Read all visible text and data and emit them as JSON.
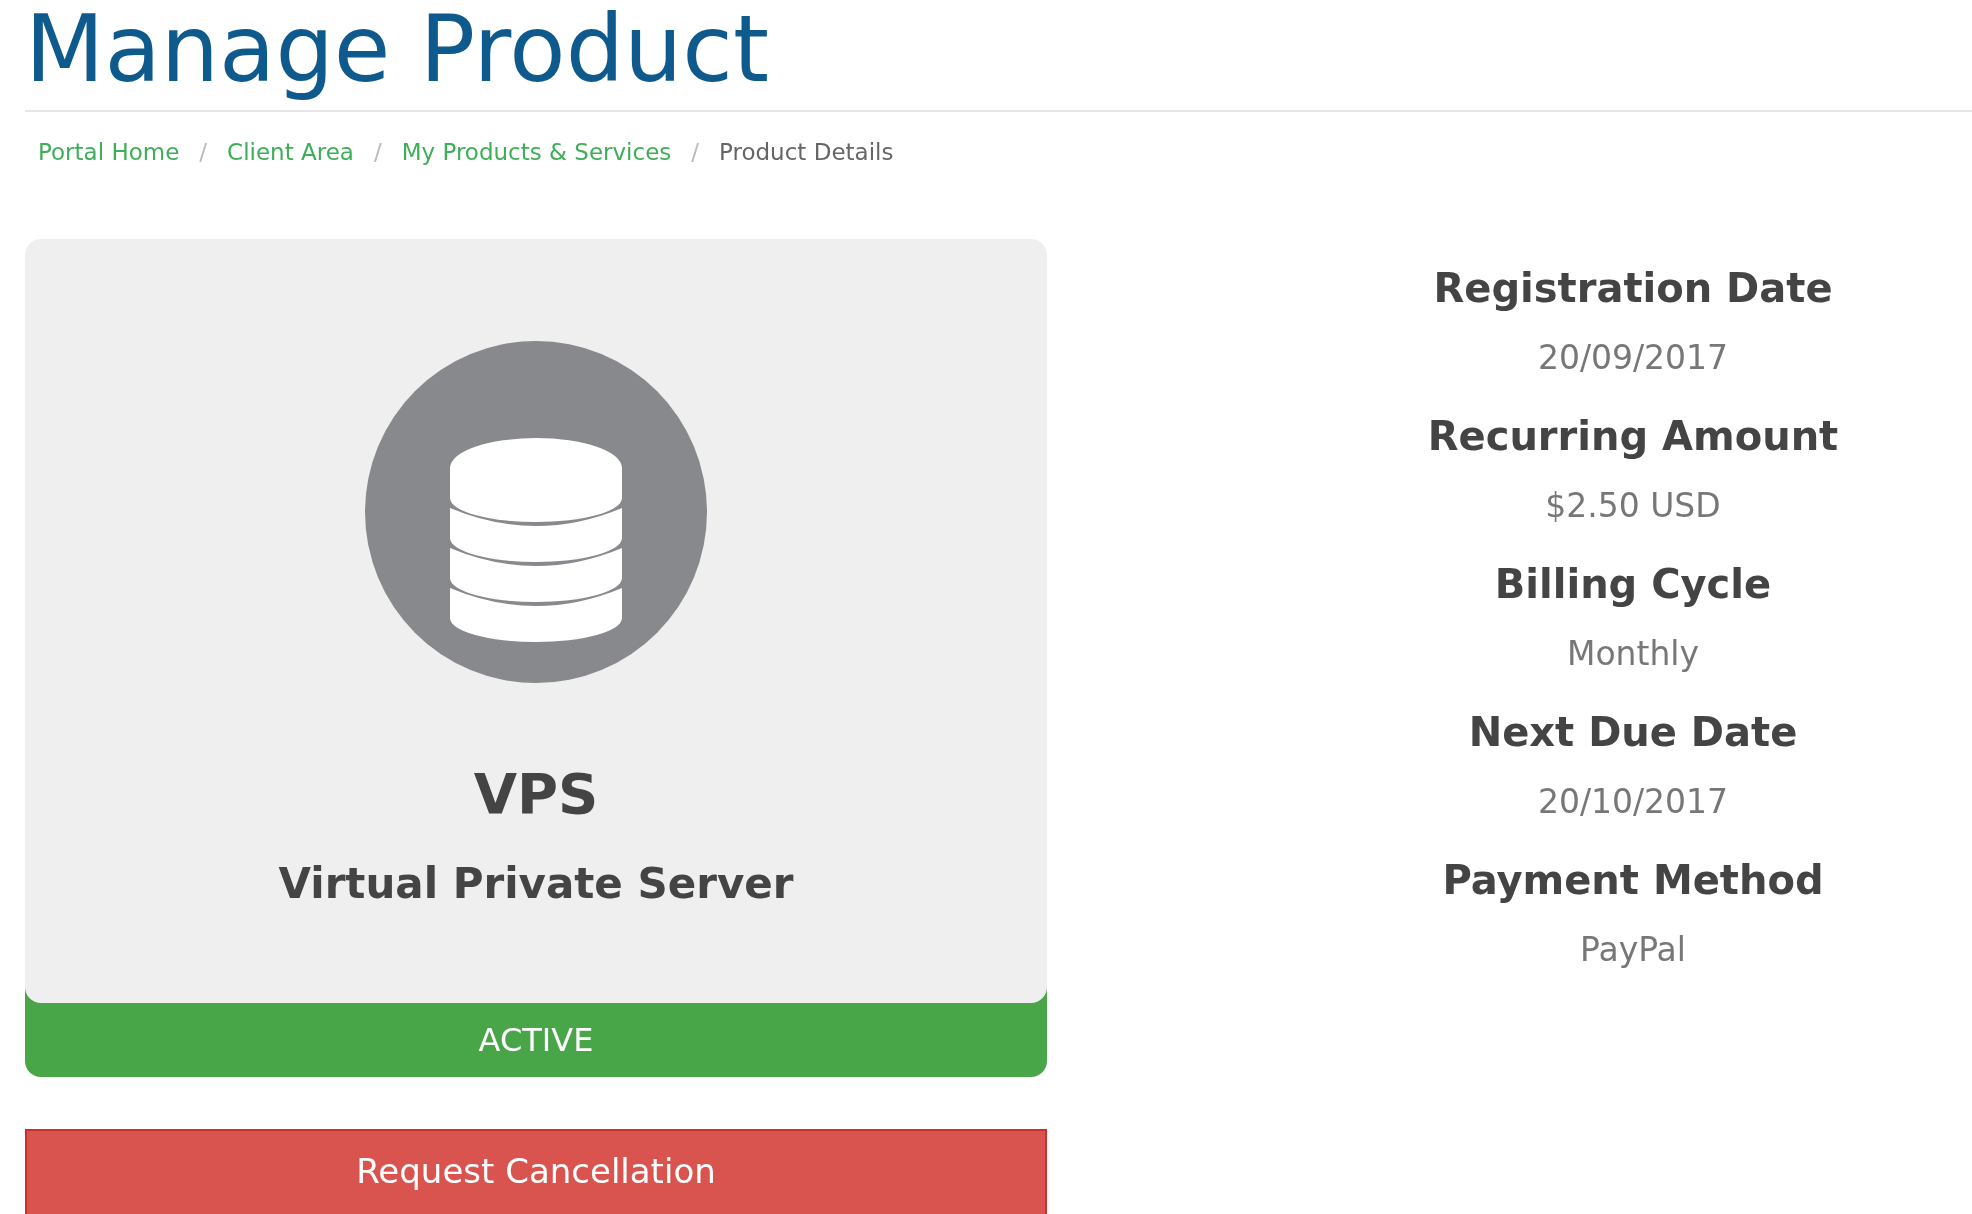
{
  "page_title": "Manage Product",
  "breadcrumb": [
    {
      "label": "Portal Home",
      "kind": "link"
    },
    {
      "separator": "/",
      "label": "Client Area",
      "kind": "link"
    },
    {
      "separator": "/",
      "label": "My Products & Services",
      "kind": "link"
    },
    {
      "separator": "/",
      "label": "Product Details",
      "kind": "current"
    }
  ],
  "product": {
    "name": "VPS",
    "description": "Virtual Private Server",
    "status": "ACTIVE",
    "action": "Request Cancellation"
  },
  "details": [
    {
      "label": "Registration Date",
      "value": "20/09/2017"
    },
    {
      "label": "Recurring Amount",
      "value": "$2.50 USD"
    },
    {
      "label": "Billing Cycle",
      "value": "Monthly"
    },
    {
      "label": "Next Due Date",
      "value": "20/10/2017"
    },
    {
      "label": "Payment Method",
      "value": "PayPal"
    }
  ]
}
